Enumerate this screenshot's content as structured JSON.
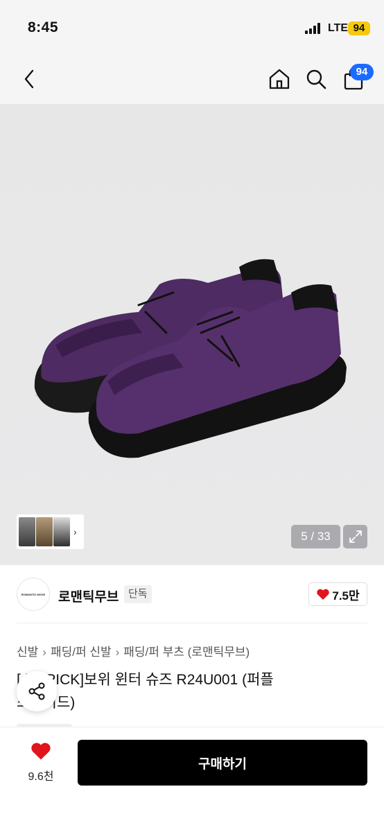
{
  "status_bar": {
    "time": "8:45",
    "network": "LTE",
    "battery": "94"
  },
  "header": {
    "cart_count": "94"
  },
  "gallery": {
    "counter": "5 / 33",
    "thumbnail_arrow": "›"
  },
  "brand": {
    "logo_text": "ROMANTIC MOVE",
    "name": "로맨틱무브",
    "tag": "단독",
    "likes": "7.5만"
  },
  "breadcrumb": [
    "신발",
    "패딩/퍼 신발",
    "패딩/퍼 부츠 (로맨틱무브)"
  ],
  "breadcrumb_sep": "›",
  "product": {
    "title_line1": "[  |수 PICK]보위 윈터 슈즈 R24U001 (퍼플",
    "title_line2": "스웨이드)"
  },
  "bottom_bar": {
    "wish_count": "9.6천",
    "buy_label": "구매하기"
  },
  "colors": {
    "accent_badge": "#1c6bff",
    "heart": "#e0151d",
    "battery": "#f6c90e",
    "product_purple": "#4e2b62"
  }
}
